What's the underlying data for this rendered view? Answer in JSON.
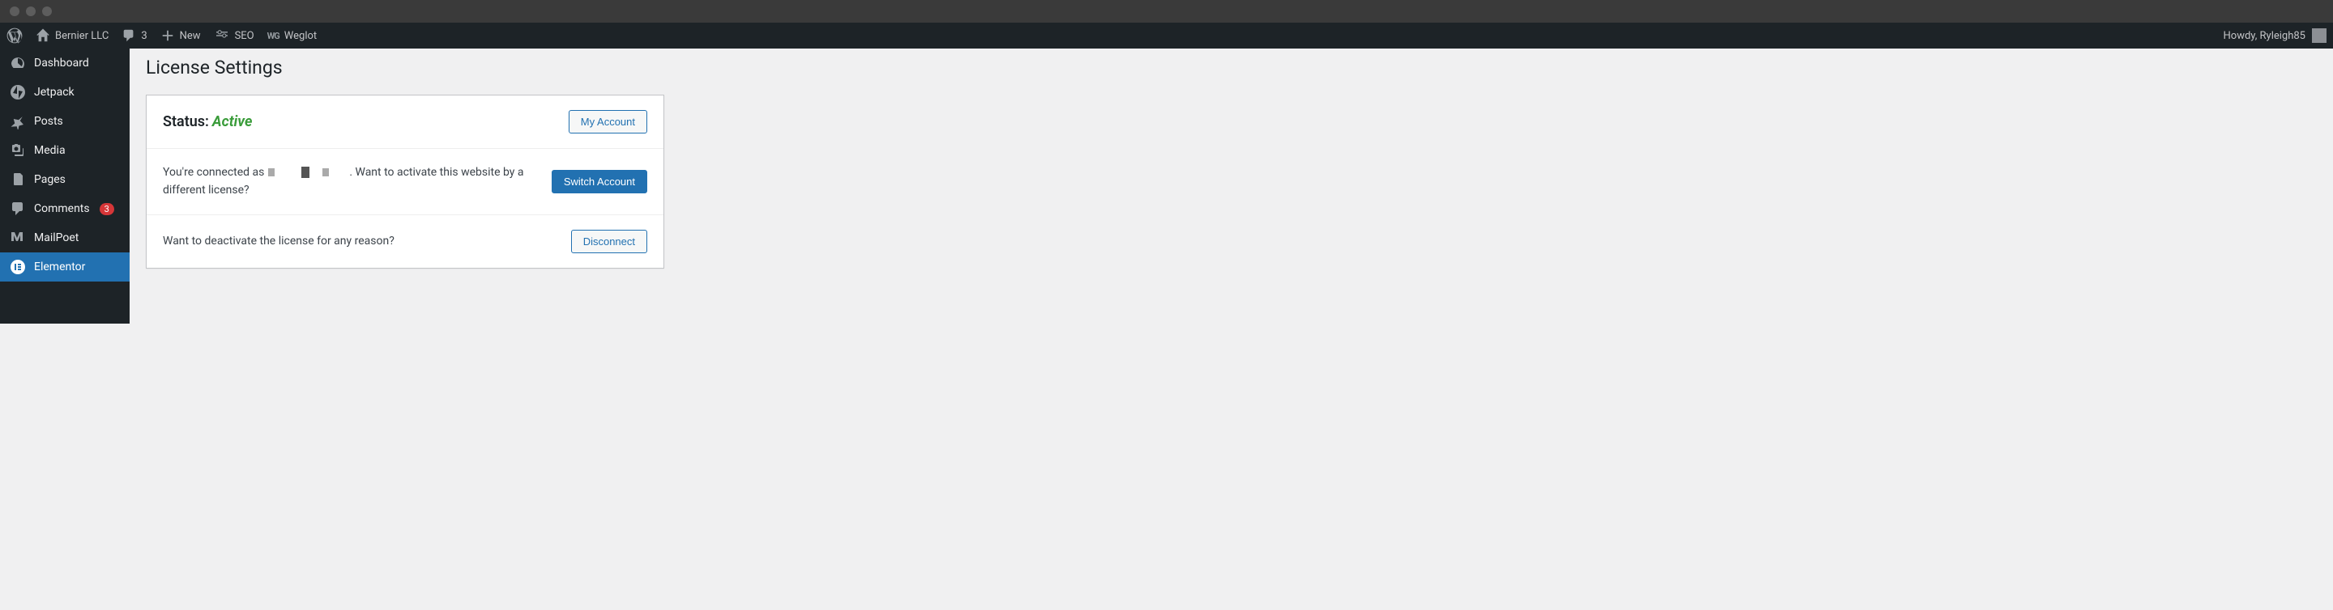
{
  "adminbar": {
    "site_name": "Bernier LLC",
    "comments_count": "3",
    "new_label": "New",
    "seo_label": "SEO",
    "weglot_label": "Weglot",
    "howdy": "Howdy, Ryleigh85"
  },
  "sidebar": {
    "dashboard": "Dashboard",
    "jetpack": "Jetpack",
    "posts": "Posts",
    "media": "Media",
    "pages": "Pages",
    "comments": "Comments",
    "comments_badge": "3",
    "mailpoet": "MailPoet",
    "elementor": "Elementor"
  },
  "page": {
    "title": "License Settings",
    "status_label": "Status:",
    "status_value": "Active",
    "my_account_btn": "My Account",
    "connected_prefix": "You're connected as",
    "connected_suffix": ". Want to activate this website by a different license?",
    "switch_btn": "Switch Account",
    "deactivate_text": "Want to deactivate the license for any reason?",
    "disconnect_btn": "Disconnect"
  }
}
